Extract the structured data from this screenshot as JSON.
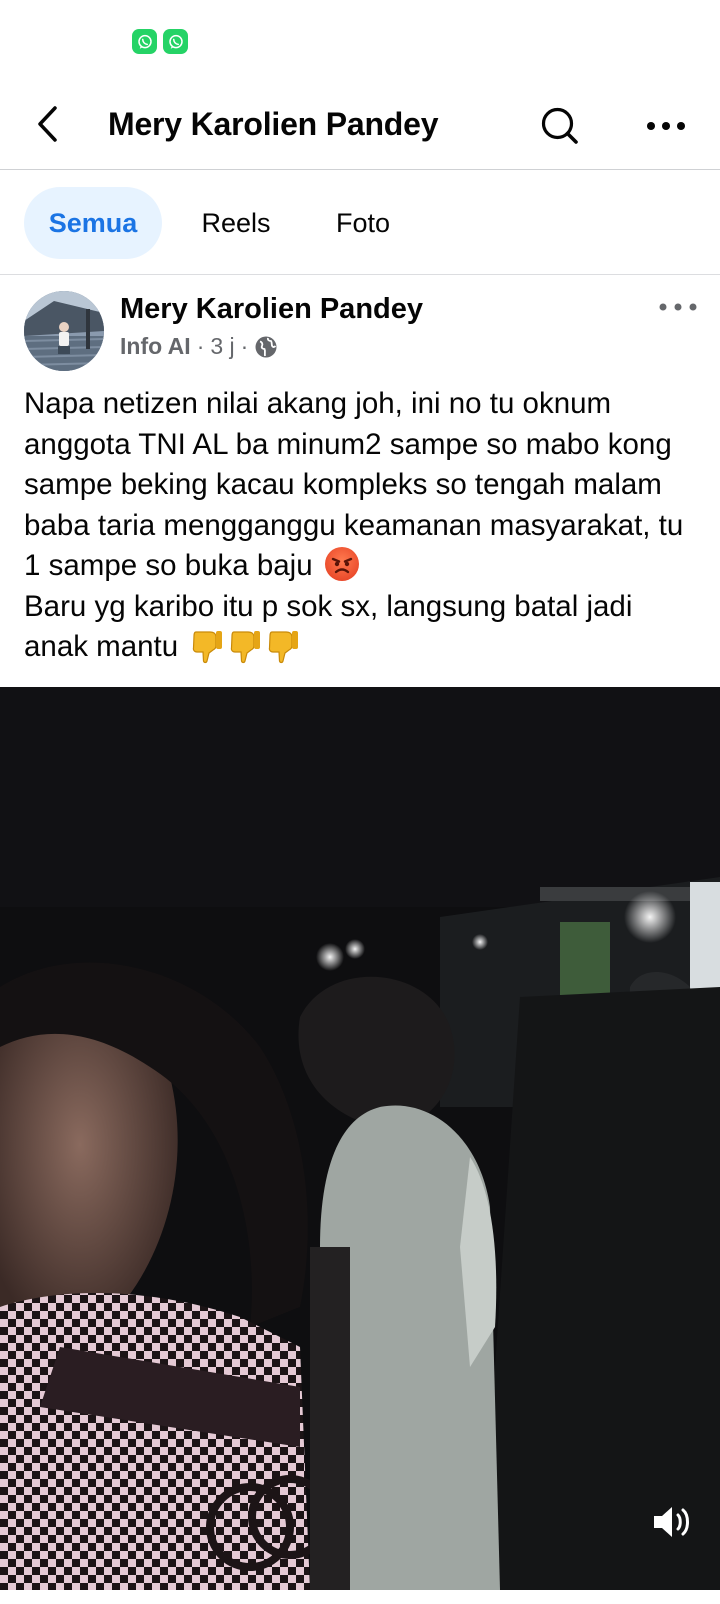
{
  "status_bar": {
    "icons": [
      "whatsapp-icon",
      "whatsapp-icon"
    ]
  },
  "header": {
    "title": "Mery Karolien Pandey",
    "icons": [
      "back-arrow-icon",
      "search-icon",
      "more-icon"
    ]
  },
  "tabs": [
    {
      "label": "Semua",
      "active": true
    },
    {
      "label": "Reels",
      "active": false
    },
    {
      "label": "Foto",
      "active": false
    }
  ],
  "post": {
    "author": "Mery Karolien Pandey",
    "badge": "Info AI",
    "time": "3 j",
    "separator": "·",
    "audience_icon": "globe-icon",
    "text_part1": "Napa netizen nilai akang joh, ini no tu oknum anggota TNI AL ba minum2 sampe so mabo kong sampe beking kacau kompleks so tengah malam baba taria mengganggu keamanan masyarakat, tu 1 sampe so buka baju",
    "emoji_1": "angry-face-emoji",
    "text_part2": "Baru yg karibo itu p sok sx, langsung batal jadi anak mantu",
    "emoji_2": [
      "thumbs-down-emoji",
      "thumbs-down-emoji",
      "thumbs-down-emoji"
    ]
  },
  "video": {
    "volume_icon": "volume-icon"
  },
  "colors": {
    "accent": "#1b74e4",
    "active_tab_bg": "#e7f3ff",
    "text": "#050505",
    "secondary": "#65676b",
    "whatsapp": "#25D366"
  }
}
